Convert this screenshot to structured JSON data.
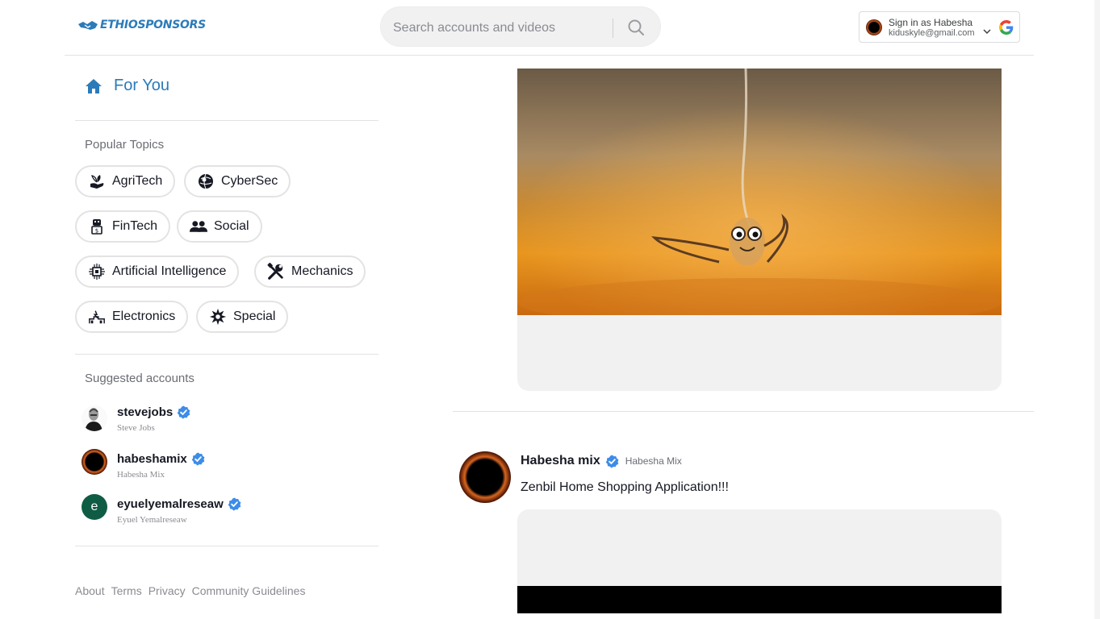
{
  "brand": {
    "name": "ETHIOSPONSORS",
    "color": "#2b7bb9"
  },
  "search": {
    "placeholder": "Search accounts and videos"
  },
  "signin": {
    "line1": "Sign in as Habesha",
    "email": "kiduskyle@gmail.com"
  },
  "sidebar": {
    "for_you": "For You",
    "popular_topics_title": "Popular Topics",
    "topics": [
      {
        "label": "AgriTech",
        "icon": "sprout-hand-icon"
      },
      {
        "label": "CyberSec",
        "icon": "hacker-globe-icon"
      },
      {
        "label": "FinTech",
        "icon": "money-robot-icon"
      },
      {
        "label": "Social",
        "icon": "users-icon"
      },
      {
        "label": "Artificial Intelligence",
        "icon": "circuit-brain-icon"
      },
      {
        "label": "Mechanics",
        "icon": "tools-icon"
      },
      {
        "label": "Electronics",
        "icon": "plug-icon"
      },
      {
        "label": "Special",
        "icon": "star-badge-icon"
      }
    ],
    "suggested_title": "Suggested accounts",
    "accounts": [
      {
        "username": "stevejobs",
        "name": "Steve Jobs",
        "verified": true
      },
      {
        "username": "habeshamix",
        "name": "Habesha Mix",
        "verified": true
      },
      {
        "username": "eyuelyemalreseaw",
        "name": "Eyuel Yemalreseaw",
        "verified": true,
        "initial": "e"
      }
    ],
    "footer": [
      "About",
      "Terms",
      "Privacy",
      "Community Guidelines"
    ]
  },
  "feed": {
    "post": {
      "username": "Habesha mix",
      "nickname": "Habesha Mix",
      "caption": "Zenbil Home Shopping Application!!!"
    }
  },
  "colors": {
    "verified": "#20d5ec",
    "verified_badge": "#3d8ce8",
    "accent": "#2b7bb9"
  }
}
